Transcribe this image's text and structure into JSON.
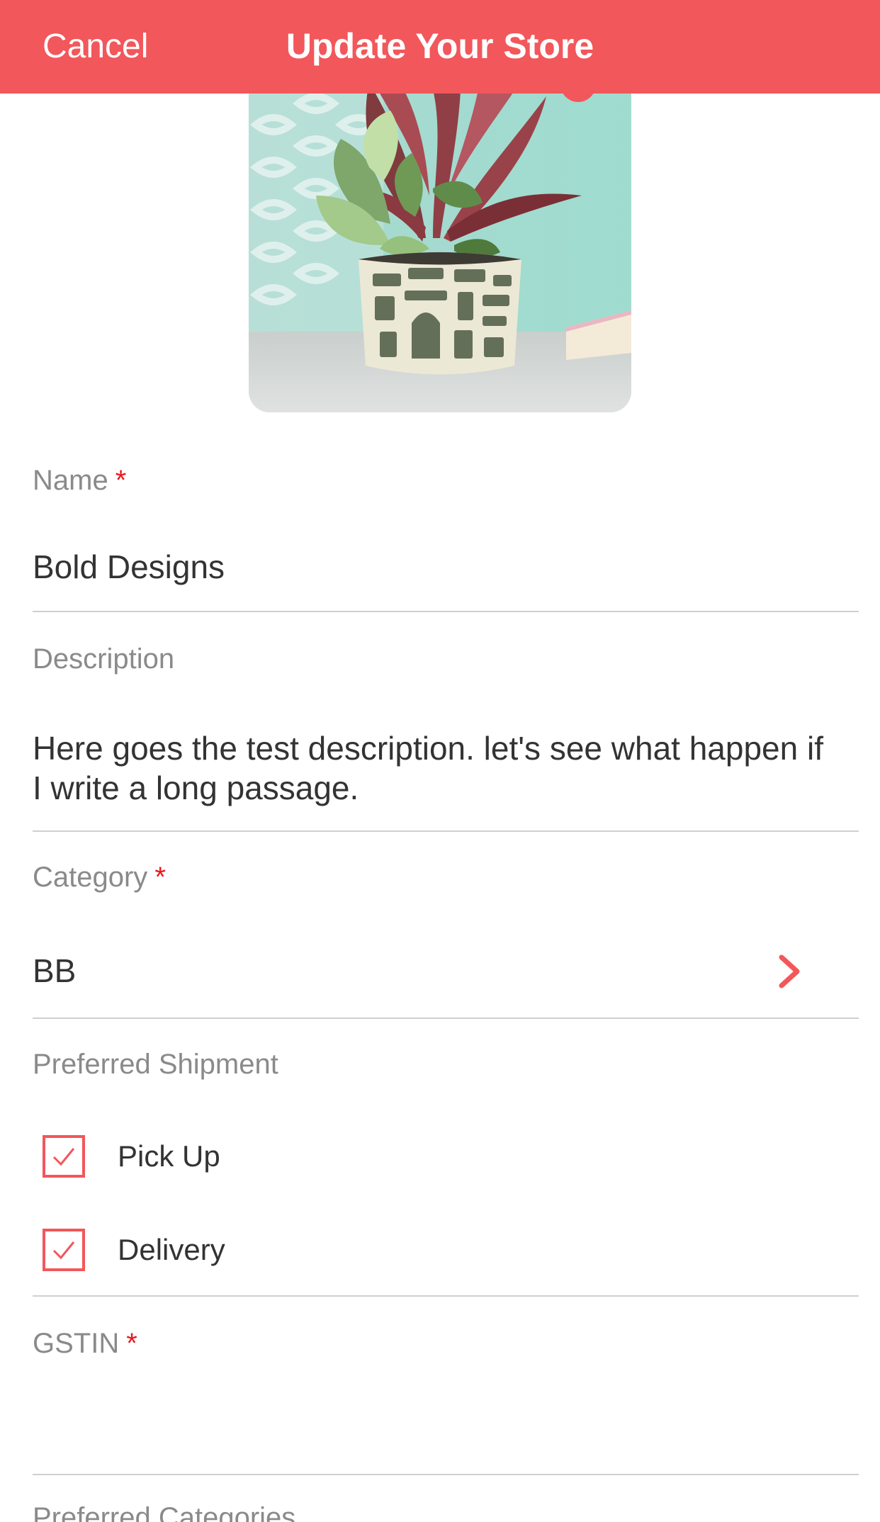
{
  "header": {
    "cancel_label": "Cancel",
    "title": "Update Your Store"
  },
  "colors": {
    "accent": "#f2575b",
    "required": "#e8191f",
    "label": "#8a8a8a",
    "value": "#333333",
    "divider": "#cfcfcf"
  },
  "store_image": {
    "icon": "plant-photo"
  },
  "form": {
    "name": {
      "label": "Name",
      "required": "*",
      "value": "Bold Designs"
    },
    "description": {
      "label": "Description",
      "value": "Here goes the test description. let's see what happen if I write a long passage."
    },
    "category": {
      "label": "Category",
      "required": "*",
      "value": "BB",
      "icon": "chevron-right-icon"
    },
    "shipment": {
      "label": "Preferred Shipment",
      "options": [
        {
          "label": "Pick Up",
          "checked": true
        },
        {
          "label": "Delivery",
          "checked": true
        }
      ]
    },
    "gstin": {
      "label": "GSTIN",
      "required": "*",
      "value": ""
    },
    "preferred_categories": {
      "label": "Preferred Categories"
    }
  }
}
